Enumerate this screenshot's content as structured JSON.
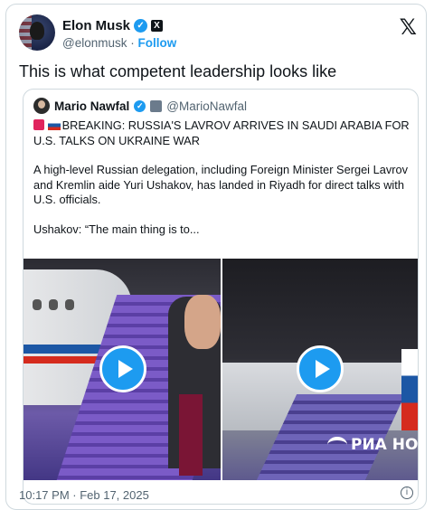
{
  "author": {
    "name": "Elon Musk",
    "handle": "@elonmusk",
    "follow_label": "Follow"
  },
  "tweet_text": "This is what competent leadership looks like",
  "quoted": {
    "name": "Mario Nawfal",
    "handle": "@MarioNawfal",
    "headline": "BREAKING: RUSSIA'S LAVROV ARRIVES IN SAUDI ARABIA FOR U.S. TALKS ON UKRAINE WAR",
    "paragraph": "A high-level Russian delegation, including Foreign Minister Sergei Lavrov and Kremlin aide Yuri Ushakov, has landed in Riyadh for direct talks with U.S. officials.",
    "quote_start": "Ushakov: “The main thing is to...",
    "watermark": "РИА НО"
  },
  "footer": {
    "timestamp": "10:17 PM · Feb 17, 2025"
  },
  "icons": [
    "verified-badge-icon",
    "x-affiliate-icon",
    "x-logo-icon",
    "play-icon",
    "info-icon"
  ],
  "colors": {
    "accent": "#1d9bf0",
    "text": "#0f1419",
    "muted": "#536471",
    "border": "#cfd9de"
  }
}
